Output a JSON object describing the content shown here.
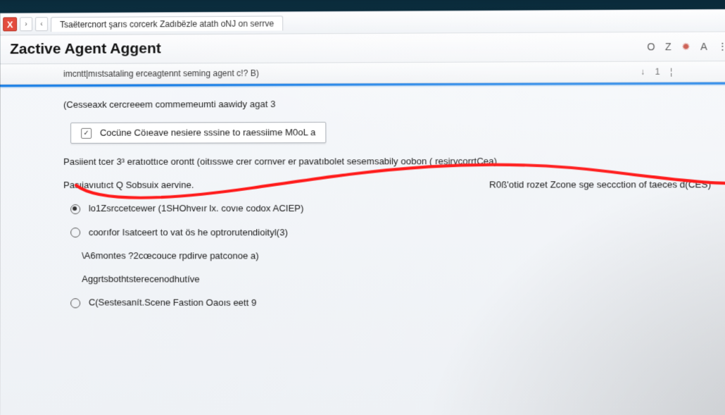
{
  "colors": {
    "accent": "#1a7fe6",
    "annotation": "#ff1a1a",
    "close": "#e34b3d"
  },
  "tabstrip": {
    "close_glyph": "X",
    "back_glyph": "›",
    "fwd_glyph": "‹",
    "tab_title": "Tsaëtercnort şarıs corcerk Zadıbëzle atath oNJ on serrve"
  },
  "titlebar": {
    "title": "Zactive Agent Aggent",
    "icons": {
      "circle": "O",
      "zed": "Z",
      "flame": "✹",
      "letter": "A",
      "more": "⋮"
    }
  },
  "subheader": {
    "text": "imcntt|mıstsataling erceagtennt seming agent c!? B)",
    "icons": {
      "down": "↓",
      "count": "1",
      "split": "¦"
    }
  },
  "content": {
    "line1": "(Cesseaxk cercreeem commemeumti aawidy agat 3",
    "box_checked": true,
    "box_text": "Cocüne Cöıeave nesiere sssine to raessiime M0oL a",
    "line3": "Pasiient tcer 3³ eratıottıce orontt (oitısswe crer cornver er pavatıbolet sesemsabily oobon ( resirvcorrtCea)",
    "right_note": "R0ß'otid rozet Zcone sge seccction of taeces d(CES)",
    "line4": "Pasıiavıutıct Q Sobsuix aervine.",
    "radio1": {
      "selected": true,
      "text": "lo1Zsrccetcewer (1SHOhveır lx. covıe codox ACIEP)"
    },
    "radio2": {
      "selected": false,
      "text": "coorıfor Isatceert to vat ös he optrorutendioityl(3)"
    },
    "line7": "\\A6montes ?2cœcouce rpdirve patconoe a)",
    "line8": "Aggrtsbothtsterecenodhutíve",
    "radio3": {
      "selected": false,
      "text": "C(Sestesanít.Scene Fastion Oaoıs eett 9"
    }
  }
}
